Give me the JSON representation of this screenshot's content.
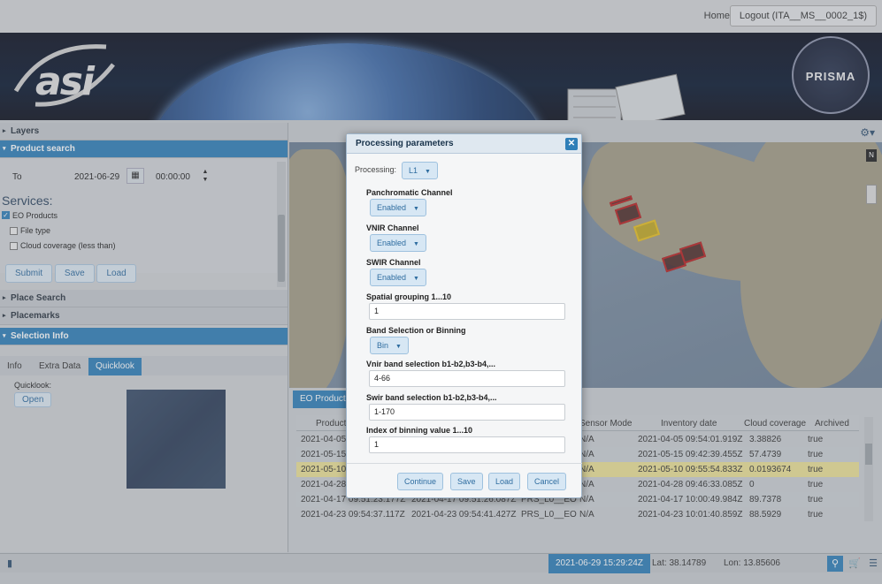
{
  "topbar": {
    "home": "Home",
    "logout": "Logout (ITA__MS__0002_1$)"
  },
  "banner": {
    "asi_logo_text": "asi",
    "prisma_text": "PRISMA"
  },
  "left_panel": {
    "layers": "Layers",
    "product_search": "Product search",
    "to_label": "To",
    "to_date": "2021-06-29",
    "to_time": "00:00:00",
    "services_label": "Services:",
    "eo_products": "EO Products",
    "file_type": "File type",
    "cloud_coverage": "Cloud coverage (less than)",
    "submit": "Submit",
    "save": "Save",
    "load": "Load",
    "place_search": "Place Search",
    "placemarks": "Placemarks",
    "selection_info": "Selection Info",
    "tabs": [
      "Info",
      "Extra Data",
      "Quicklook"
    ],
    "quicklook_label": "Quicklook:",
    "open": "Open"
  },
  "products": {
    "tab": "EO Products",
    "columns": [
      "Product",
      "Sensor Mode",
      "Inventory date",
      "Cloud coverage",
      "Archived"
    ],
    "rows": [
      {
        "start": "2021-04-05",
        "stop": "",
        "type": "",
        "mode": "N/A",
        "inv": "2021-04-05 09:54:01.919Z",
        "cloud": "3.38826",
        "arch": "true"
      },
      {
        "start": "2021-05-15",
        "stop": "",
        "type": "",
        "mode": "N/A",
        "inv": "2021-05-15 09:42:39.455Z",
        "cloud": "57.4739",
        "arch": "true"
      },
      {
        "start": "2021-05-10",
        "stop": "",
        "type": "",
        "mode": "N/A",
        "inv": "2021-05-10 09:55:54.833Z",
        "cloud": "0.0193674",
        "arch": "true"
      },
      {
        "start": "2021-04-28",
        "stop": "",
        "type": "",
        "mode": "N/A",
        "inv": "2021-04-28 09:46:33.085Z",
        "cloud": "0",
        "arch": "true"
      },
      {
        "start": "2021-04-17 09:51:23.177Z",
        "stop": "2021-04-17 09:51:26.087Z",
        "type": "PRS_L0__EO",
        "mode": "N/A",
        "inv": "2021-04-17 10:00:49.984Z",
        "cloud": "89.7378",
        "arch": "true"
      },
      {
        "start": "2021-04-23 09:54:37.117Z",
        "stop": "2021-04-23 09:54:41.427Z",
        "type": "PRS_L0__EO",
        "mode": "N/A",
        "inv": "2021-04-23 10:01:40.859Z",
        "cloud": "88.5929",
        "arch": "true"
      }
    ]
  },
  "statusbar": {
    "datetime": "2021-06-29 15:29:24Z",
    "lat": "Lat: 38.14789",
    "lon": "Lon: 13.85606"
  },
  "modal": {
    "title": "Processing parameters",
    "processing_label": "Processing:",
    "processing_value": "L1",
    "pan_label": "Panchromatic Channel",
    "pan_value": "Enabled",
    "vnir_label": "VNIR Channel",
    "vnir_value": "Enabled",
    "swir_label": "SWIR Channel",
    "swir_value": "Enabled",
    "spatial_label": "Spatial grouping 1...10",
    "spatial_value": "1",
    "band_sel_label": "Band Selection or Binning",
    "band_sel_value": "Bin",
    "vnir_band_label": "Vnir band selection b1-b2,b3-b4,...",
    "vnir_band_value": "4-66",
    "swir_band_label": "Swir band selection b1-b2,b3-b4,...",
    "swir_band_value": "1-170",
    "binning_label": "Index of binning value 1...10",
    "binning_value": "1",
    "continue": "Continue",
    "save": "Save",
    "load": "Load",
    "cancel": "Cancel"
  },
  "colors": {
    "accent": "#2f7fb8",
    "highlight_row": "#ece296",
    "footprint": "#b22222"
  }
}
